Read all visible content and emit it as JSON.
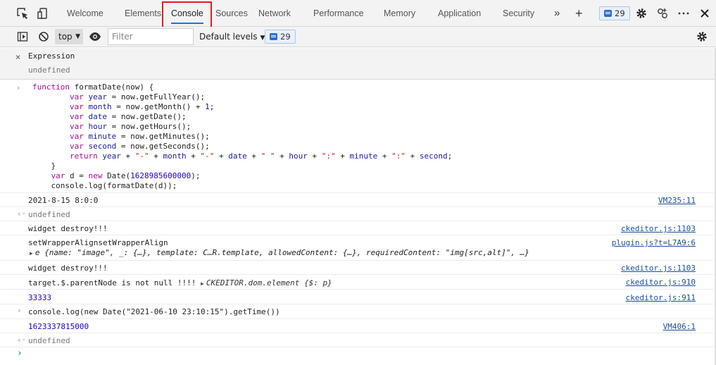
{
  "tabs": {
    "welcome": "Welcome",
    "elements": "Elements",
    "console": "Console",
    "sources": "Sources",
    "network": "Network",
    "performance": "Performance",
    "memory": "Memory",
    "application": "Application",
    "security": "Security",
    "more": "»",
    "add": "+",
    "issues_count": "29"
  },
  "toolbar": {
    "context": "top",
    "filter_placeholder": "Filter",
    "levels": "Default levels",
    "issues_count": "29"
  },
  "expression": {
    "title": "Expression",
    "value": "undefined"
  },
  "code_lines": [
    "function formatDate(now) {",
    "        var year = now.getFullYear();",
    "        var month = now.getMonth() + 1;",
    "        var date = now.getDate();",
    "        var hour = now.getHours();",
    "        var minute = now.getMinutes();",
    "        var second = now.getSeconds();",
    "        return year + \"-\" + month + \"-\" + date + \" \" + hour + \":\" + minute + \":\" + second;",
    "    }",
    "    var d = new Date(1628985600000);",
    "    console.log(formatDate(d));"
  ],
  "console": {
    "out1": "2021-8-15 8:0:0",
    "out1_src": "VM235:11",
    "ret1": "undefined",
    "widget1": "widget destroy!!!",
    "widget1_src": "ckeditor.js:1103",
    "wrapper": "setWrapperAlignsetWrapperAlign",
    "wrapper_src": "plugin.js?t=L7A9:6",
    "wrapper_obj": "e {name: \"image\", _: {…}, template: C…R.template, allowedContent: {…}, requiredContent: \"img[src,alt]\", …}",
    "widget2": "widget destroy!!!",
    "widget2_src": "ckeditor.js:1103",
    "target": "target.$.parentNode is not null !!!! ",
    "target_obj": "CKEDITOR.dom.element {$: p}",
    "target_src": "ckeditor.js:910",
    "num": "33333",
    "num_src": "ckeditor.js:911",
    "cmd": "console.log(new Date(\"2021-06-10 23:10:15\").getTime())",
    "time": "1623337815000",
    "time_src": "VM406:1",
    "ret2": "undefined"
  },
  "icons": {
    "inspect": "inspect-element-icon",
    "device": "device-toolbar-icon",
    "settings": "gear-icon",
    "connect": "connect-icon",
    "menu": "more-icon",
    "close": "close-icon",
    "sidebar": "sidebar-icon",
    "clear": "clear-console-icon",
    "eye": "live-expression-icon"
  }
}
